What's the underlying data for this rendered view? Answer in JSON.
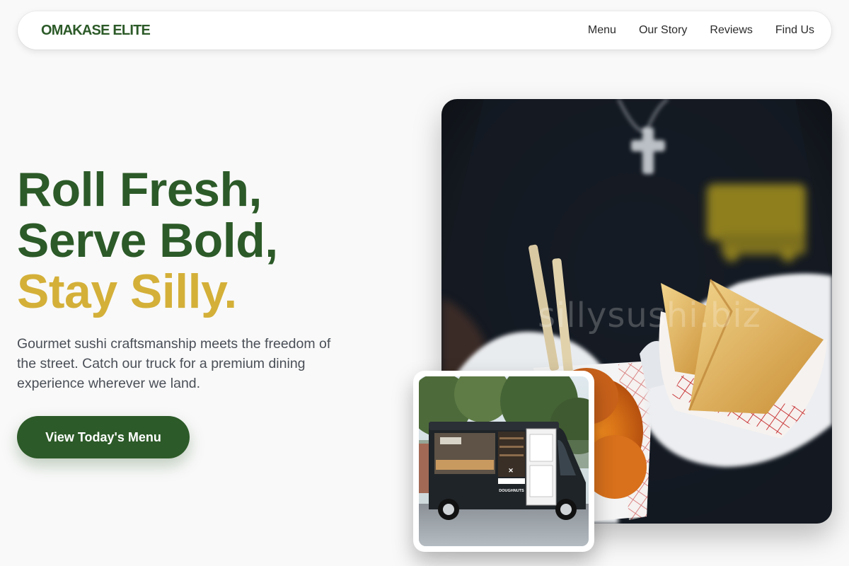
{
  "navbar": {
    "brand": "OMAKASE ELITE",
    "links": [
      "Menu",
      "Our Story",
      "Reviews",
      "Find Us"
    ]
  },
  "hero": {
    "title_line1": "Roll Fresh,",
    "title_line2": "Serve Bold,",
    "title_line3": "Stay Silly.",
    "description": "Gourmet sushi craftsmanship meets the freedom of the street. Catch our truck for a premium dining experience wherever we land.",
    "cta_label": "View Today's Menu"
  },
  "images": {
    "main_watermark": "sillysushi.biz",
    "truck_sign": "DOUGHNUTS"
  },
  "colors": {
    "primary_green": "#2c5a28",
    "accent_gold": "#d4b039",
    "text_gray": "#4a4f57",
    "background": "#f9f9f9"
  }
}
